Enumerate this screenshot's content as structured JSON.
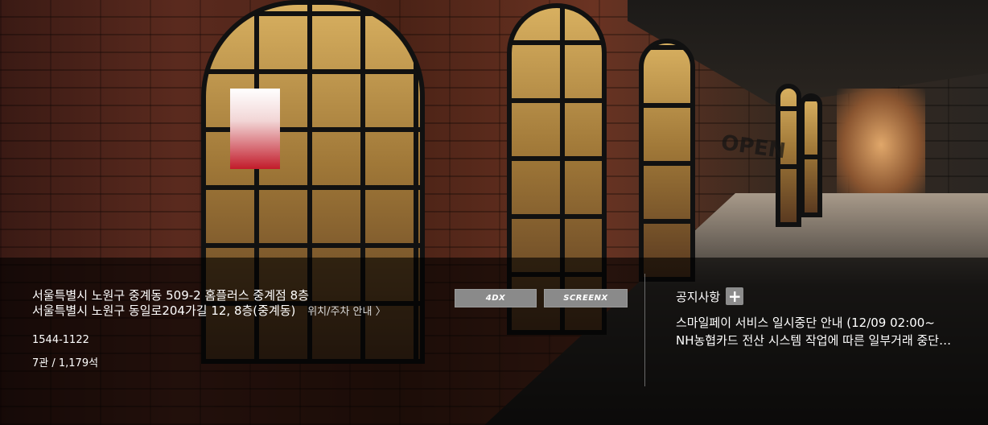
{
  "theater": {
    "address_lot": "서울특별시 노원구 중계동 509-2 홈플러스 중계점 8층",
    "address_road": "서울특별시 노원구 동일로204가길 12, 8층(중계동)",
    "location_link": "위치/주차 안내 〉",
    "phone": "1544-1122",
    "halls_seats": "7관 / 1,179석"
  },
  "formats": {
    "fmt_4dx": "4DX",
    "fmt_screenx": "SCREENX"
  },
  "notices": {
    "title": "공지사항",
    "plus_icon": "+",
    "items": [
      "스마일페이 서비스 일시중단 안내 (12/09 02:00~",
      "NH농협카드 전산 시스템 작업에 따른 일부거래 중단 안내"
    ]
  },
  "background": {
    "sign_text": "OPEN"
  }
}
